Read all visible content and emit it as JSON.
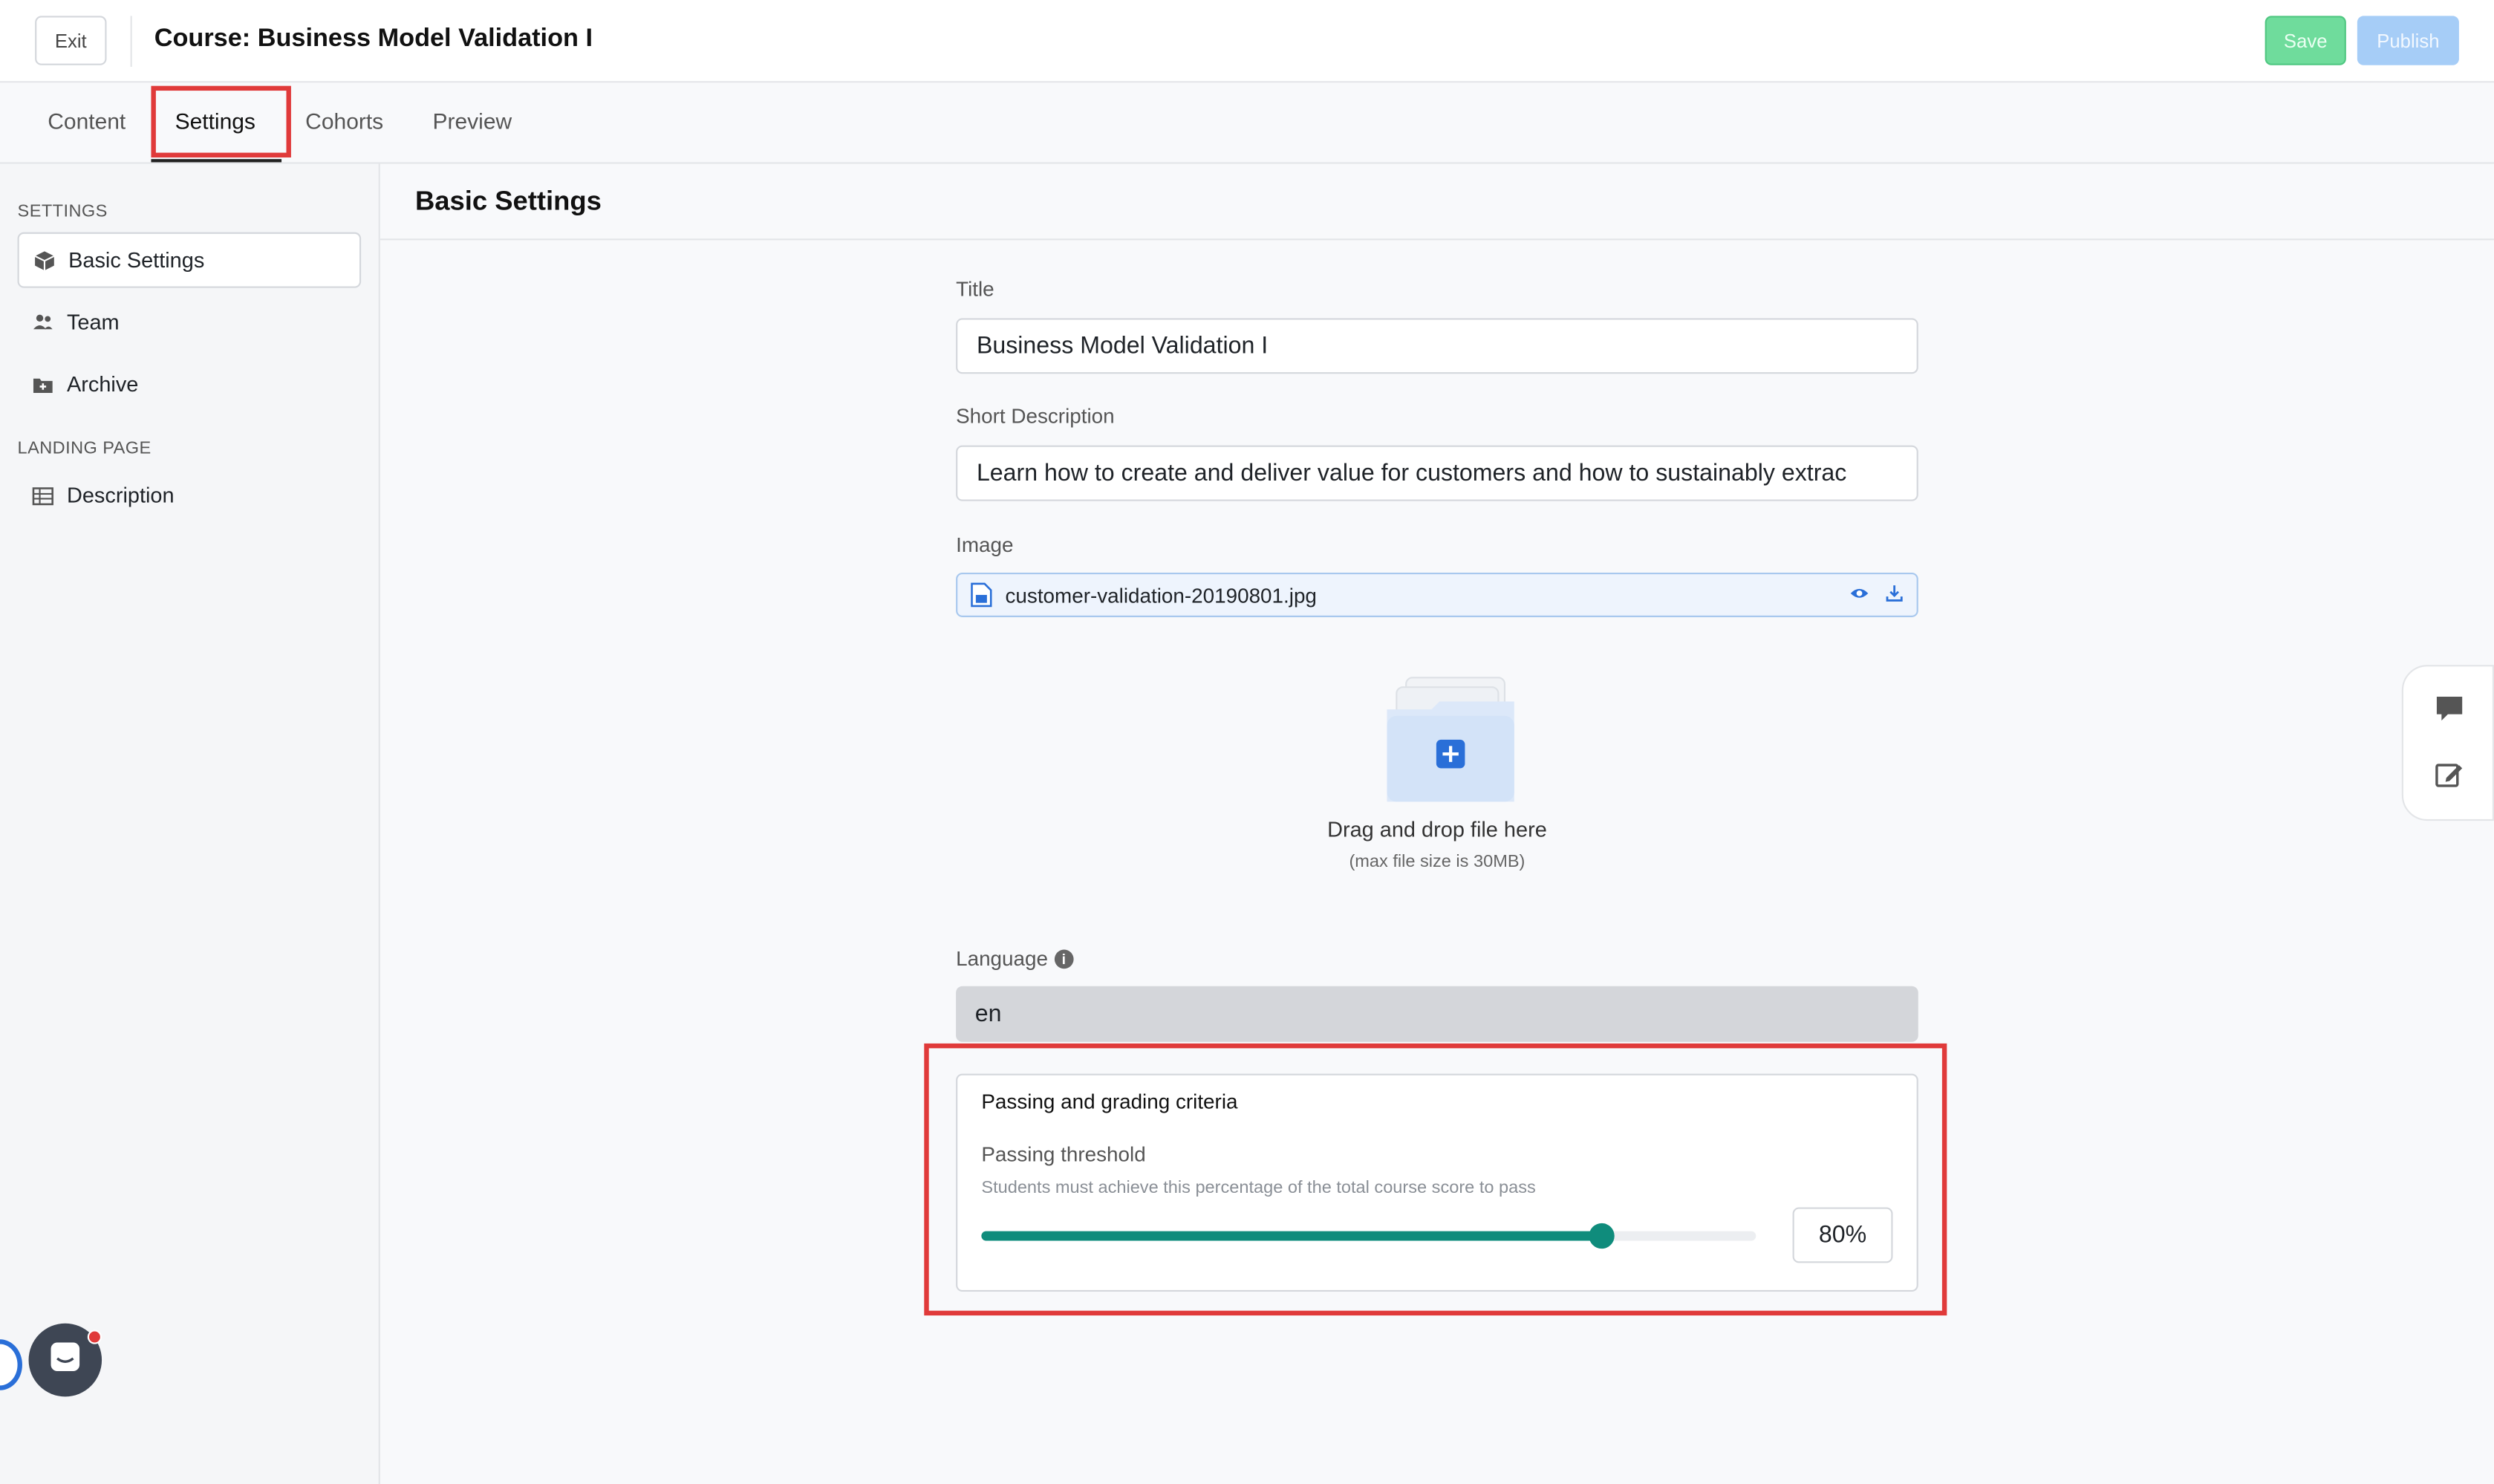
{
  "header": {
    "exit_label": "Exit",
    "course_title": "Course: Business Model Validation I",
    "save_label": "Save",
    "publish_label": "Publish"
  },
  "tabs": [
    {
      "label": "Content",
      "active": false
    },
    {
      "label": "Settings",
      "active": true
    },
    {
      "label": "Cohorts",
      "active": false
    },
    {
      "label": "Preview",
      "active": false
    }
  ],
  "sidebar": {
    "settings_heading": "SETTINGS",
    "items": [
      {
        "label": "Basic Settings",
        "icon": "cube-icon",
        "active": true
      },
      {
        "label": "Team",
        "icon": "people-icon",
        "active": false
      },
      {
        "label": "Archive",
        "icon": "archive-icon",
        "active": false
      }
    ],
    "landing_heading": "LANDING PAGE",
    "landing_items": [
      {
        "label": "Description",
        "icon": "table-icon",
        "active": false
      }
    ]
  },
  "main": {
    "title": "Basic Settings",
    "title_field": {
      "label": "Title",
      "value": "Business Model Validation I"
    },
    "short_description": {
      "label": "Short Description",
      "value": "Learn how to create and deliver value for customers and how to sustainably extrac"
    },
    "image": {
      "label": "Image",
      "file_name": "customer-validation-20190801.jpg"
    },
    "dropzone": {
      "text": "Drag and drop file here",
      "subtext": "(max file size is 30MB)"
    },
    "language": {
      "label": "Language",
      "info": "i",
      "value": "en"
    },
    "criteria": {
      "title": "Passing and grading criteria",
      "threshold_label": "Passing threshold",
      "threshold_help": "Students must achieve this percentage of the total course score to pass",
      "threshold_value": 80,
      "threshold_display": "80%"
    }
  },
  "colors": {
    "accent_green": "#0f8c7c",
    "save_green": "#6fdc9c",
    "publish_blue": "#a6cdf7",
    "highlight_red": "#e03a3a"
  }
}
